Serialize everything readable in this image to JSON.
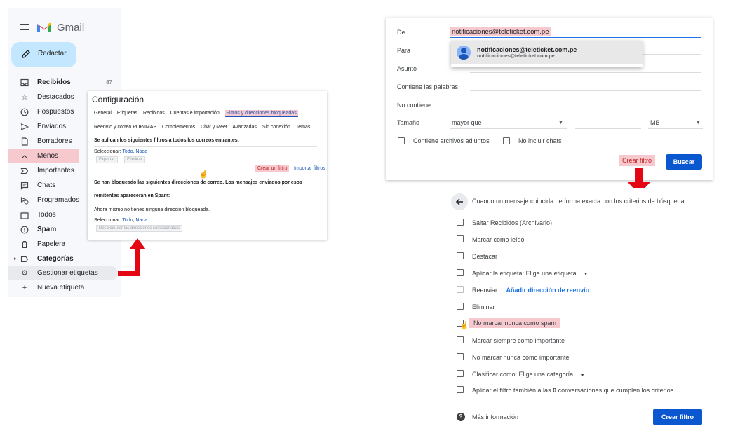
{
  "sidebar": {
    "app_name": "Gmail",
    "compose_label": "Redactar",
    "items": [
      {
        "label": "Recibidos",
        "count": "87",
        "icon": "inbox-icon",
        "bold": true
      },
      {
        "label": "Destacados",
        "icon": "star-icon"
      },
      {
        "label": "Pospuestos",
        "icon": "clock-icon"
      },
      {
        "label": "Enviados",
        "icon": "send-icon"
      },
      {
        "label": "Borradores",
        "icon": "draft-icon"
      },
      {
        "label": "Menos",
        "icon": "chevron-up-icon"
      },
      {
        "label": "Importantes",
        "icon": "important-icon"
      },
      {
        "label": "Chats",
        "icon": "chat-icon"
      },
      {
        "label": "Programados",
        "icon": "scheduled-icon"
      },
      {
        "label": "Todos",
        "icon": "all-mail-icon"
      },
      {
        "label": "Spam",
        "icon": "spam-icon",
        "bold": true
      },
      {
        "label": "Papelera",
        "icon": "trash-icon"
      },
      {
        "label": "Categorías",
        "icon": "label-icon",
        "bold": true
      },
      {
        "label": "Gestionar etiquetas",
        "icon": "gear-icon"
      },
      {
        "label": "Nueva etiqueta",
        "icon": "plus-icon"
      }
    ]
  },
  "settings": {
    "title": "Configuración",
    "tabs_row1": [
      "General",
      "Etiquetas",
      "Recibidos",
      "Cuentas e importación",
      "Filtros y direcciones bloqueadas"
    ],
    "tabs_row2": [
      "Reenvío y correo POP/IMAP",
      "Complementos",
      "Chat y Meet",
      "Avanzadas",
      "Sin conexión",
      "Temas"
    ],
    "filters_heading": "Se aplican los siguientes filtros a todos los correos entrantes:",
    "select_label": "Seleccionar:",
    "select_all": "Todo",
    "select_none": "Nada",
    "export_btn": "Exportar",
    "delete_btn": "Eliminar",
    "create_filter_link": "Crear un filtro",
    "import_filters_link": "Importar filtros",
    "blocked_heading_1": "Se han bloqueado las siguientes direcciones de correo. Los mensajes enviados por esos",
    "blocked_heading_2": "remitentes aparecerán en Spam:",
    "no_blocked": "Ahora mismo no tienes ninguna dirección bloqueada.",
    "unblock_btn": "Desbloquear las direcciones seleccionadas"
  },
  "search_form": {
    "from_label": "De",
    "from_value": "notificaciones@teleticket.com.pe",
    "to_label": "Para",
    "subject_label": "Asunto",
    "has_words_label": "Contiene las palabras",
    "not_has_label": "No contiene",
    "size_label": "Tamaño",
    "size_operator": "mayor que",
    "size_unit": "MB",
    "has_attachment_label": "Contiene archivos adjuntos",
    "exclude_chats_label": "No incluir chats",
    "create_filter_link": "Crear filtro",
    "search_btn": "Buscar",
    "suggestion": {
      "name": "notificaciones@teleticket.com.pe",
      "email": "notificaciones@teleticket.com.pe"
    }
  },
  "filter_actions": {
    "heading": "Cuando un mensaje coincida de forma exacta con los criterios de búsqueda:",
    "skip_inbox": "Saltar Recibidos (Archivarlo)",
    "mark_read": "Marcar como leído",
    "star": "Destacar",
    "apply_label": "Aplicar la etiqueta:",
    "apply_label_select": "Elige una etiqueta...",
    "forward": "Reenviar",
    "forward_link": "Añadir dirección de reenvío",
    "delete": "Eliminar",
    "never_spam": "No marcar nunca como spam",
    "always_important": "Marcar siempre como importante",
    "never_important": "No marcar nunca como importante",
    "categorize": "Clasificar como:",
    "categorize_select": "Elige una categoría...",
    "apply_existing_pre": "Aplicar el filtro también a las",
    "apply_existing_count": "0",
    "apply_existing_post": "conversaciones que cumplen los criterios.",
    "more_info": "Más información",
    "create_btn": "Crear filtro"
  },
  "colors": {
    "highlight": "#f6c9cf",
    "arrow": "#e30613",
    "primary_blue": "#0b57d0",
    "compose_bg": "#c2e7ff",
    "sidebar_bg": "#f6f8fc"
  }
}
